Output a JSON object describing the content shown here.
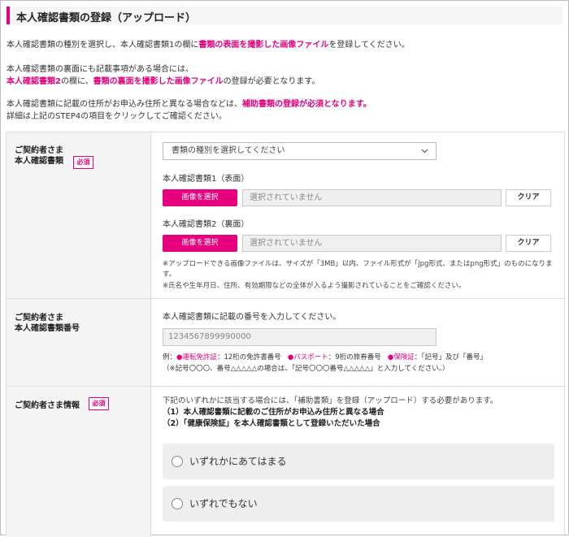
{
  "page": {
    "title": "本人確認書類の登録（アップロード）"
  },
  "intro": {
    "p1": {
      "a": "本人確認書類の種別を選択し、本人確認書類1の欄に",
      "b": "書類の表面を撮影した画像ファイル",
      "c": "を登録してください。"
    },
    "p2_line1": "本人確認書類の裏面にも記載事項がある場合には、",
    "p2_line2": {
      "a": "本人確認書類2",
      "b": "の欄に、",
      "c": "書類の裏面を撮影した画像ファイル",
      "d": "の登録が必要となります。"
    },
    "p3_line1": {
      "a": "本人確認書類に記載の住所がお申込み住所と異なる場合などは、",
      "b": "補助書類の登録が必須となります。"
    },
    "p3_line2": "詳細は上記のSTEP4の項目をクリックしてご確認ください。"
  },
  "required_badge": "必須",
  "row1": {
    "label_line1": "ご契約者さま",
    "label_line2": "本人確認書類",
    "select_placeholder": "書類の種別を選択してください",
    "doc1_label": "本人確認書類1（表面）",
    "doc2_label": "本人確認書類2（裏面）",
    "select_image_button": "画像を選択",
    "file_placeholder": "選択されていません",
    "clear_button": "クリア",
    "note1": "※アップロードできる画像ファイルは、サイズが「3MB」以内、ファイル形式が「jpg形式、またはpng形式」のものになりま",
    "note1b": "す。",
    "note2": "※氏名や生年月日、住所、有効期限などの全体が入るよう撮影されていることをご確認ください。"
  },
  "row2": {
    "label_line1": "ご契約者さま",
    "label_line2": "本人確認書類番号",
    "instruction": "本人確認書類に記載の番号を入力してください。",
    "number_placeholder": "1234567899990000",
    "example": {
      "prefix": "例：",
      "item1_name": "●運転免許証",
      "item1_desc": "：12桁の免許書番号",
      "item2_name": "●パスポート",
      "item2_desc": "：9桁の旅券番号",
      "item3_name": "●保険証",
      "item3_desc": "：「記号」及び「番号」"
    },
    "example_note": "（※記号〇〇〇、番号△△△△△の場合は、「記号〇〇〇番号△△△△△」と入力してください。）"
  },
  "row3": {
    "label": "ご契約者さま情報",
    "intro": "下記のいずれかに該当する場合には、「補助書類」を登録（アップロード）する必要があります。",
    "case1": "（1）本人確認書類に記載のご住所がお申込み住所と異なる場合",
    "case2": "（2）「健康保険証」を本人確認書類として登録いただいた場合",
    "option1": "いずれかにあてはまる",
    "option2": "いずれでもない"
  },
  "colors": {
    "accent": "#e6007e",
    "label_bg": "#f4f4f4",
    "input_bg": "#f0f0f0"
  },
  "icons": {
    "select_arrow": "chevron-down-icon",
    "radio": "radio-icon"
  }
}
